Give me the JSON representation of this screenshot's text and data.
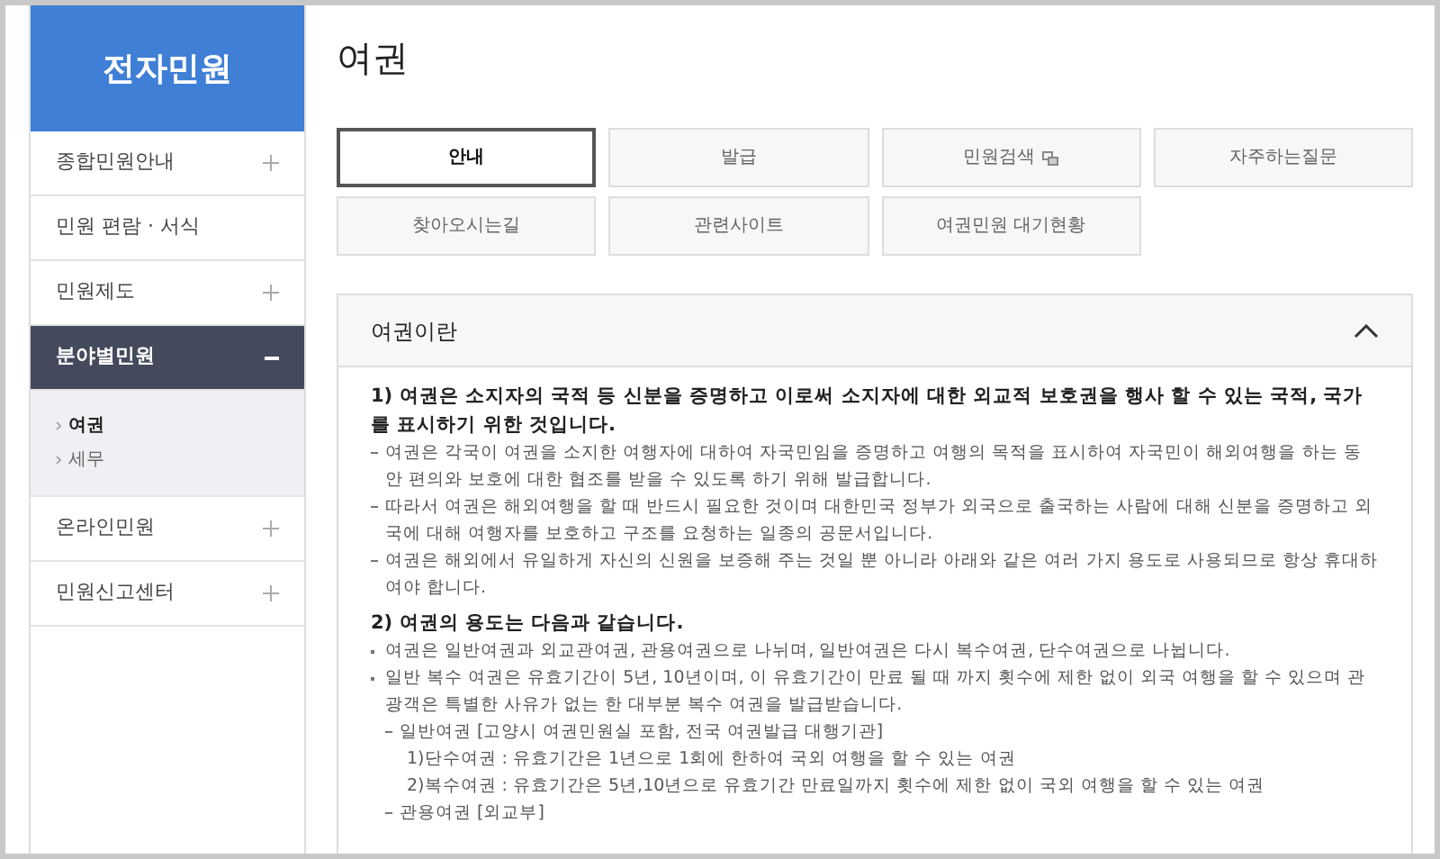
{
  "sidebar": {
    "title": "전자민원",
    "items": [
      {
        "label": "종합민원안내",
        "expandable": true,
        "expanded": false
      },
      {
        "label": "민원 편람 · 서식",
        "expandable": false,
        "expanded": false
      },
      {
        "label": "민원제도",
        "expandable": true,
        "expanded": false
      },
      {
        "label": "분야별민원",
        "expandable": true,
        "expanded": true,
        "children": [
          {
            "label": "여권",
            "selected": true
          },
          {
            "label": "세무",
            "selected": false
          }
        ]
      },
      {
        "label": "온라인민원",
        "expandable": true,
        "expanded": false
      },
      {
        "label": "민원신고센터",
        "expandable": true,
        "expanded": false
      }
    ]
  },
  "page_title": "여권",
  "tabs": [
    {
      "label": "안내",
      "selected": true,
      "external": false
    },
    {
      "label": "발급",
      "selected": false,
      "external": false
    },
    {
      "label": "민원검색",
      "selected": false,
      "external": true
    },
    {
      "label": "자주하는질문",
      "selected": false,
      "external": false
    },
    {
      "label": "찾아오시는길",
      "selected": false,
      "external": false
    },
    {
      "label": "관련사이트",
      "selected": false,
      "external": false
    },
    {
      "label": "여권민원 대기현황",
      "selected": false,
      "external": false
    }
  ],
  "panel": {
    "title": "여권이란",
    "expanded": true,
    "sections": [
      {
        "heading": "1) 여권은 소지자의 국적 등 신분을 증명하고 이로써 소지자에 대한 외교적 보호권을 행사 할 수 있는 국적, 국가를 표시하기 위한 것입니다.",
        "items": [
          {
            "kind": "dash",
            "text": "여권은 각국이 여권을 소지한 여행자에 대하여 자국민임을 증명하고 여행의 목적을 표시하여 자국민이 해외여행을 하는 동안 편의와 보호에 대한 협조를 받을 수 있도록 하기 위해 발급합니다."
          },
          {
            "kind": "dash",
            "text": "따라서 여권은 해외여행을 할 때 반드시 필요한 것이며 대한민국 정부가 외국으로 출국하는 사람에 대해 신분을 증명하고 외국에 대해 여행자를 보호하고 구조를 요청하는 일종의 공문서입니다."
          },
          {
            "kind": "dash",
            "text": "여권은 해외에서 유일하게 자신의 신원을 보증해 주는 것일 뿐 아니라 아래와 같은 여러 가지 용도로 사용되므로 항상 휴대하여야 합니다."
          }
        ]
      },
      {
        "heading": "2) 여권의 용도는 다음과 같습니다.",
        "items": [
          {
            "kind": "bullet",
            "text": "여권은 일반여권과 외교관여권, 관용여권으로 나뉘며, 일반여권은 다시 복수여권, 단수여권으로 나뉩니다."
          },
          {
            "kind": "bullet",
            "text": "일반 복수 여권은 유효기간이 5년, 10년이며, 이 유효기간이 만료 될 때 까지 횟수에 제한 없이 외국 여행을 할 수 있으며 관광객은 특별한 사유가 없는 한 대부분 복수 여권을 발급받습니다."
          },
          {
            "kind": "subdash",
            "text": "일반여권 [고양시 여권민원실 포함, 전국 여권발급 대행기관]"
          },
          {
            "kind": "indent",
            "text": "1)단수여권 : 유효기간은 1년으로 1회에 한하여 국외 여행을 할 수 있는 여권"
          },
          {
            "kind": "indent",
            "text": "2)복수여권 : 유효기간은 5년,10년으로 유효기간 만료일까지 횟수에 제한 없이 국외 여행을 할 수 있는 여권"
          },
          {
            "kind": "subdash",
            "text": "관용여권 [외교부]"
          }
        ]
      }
    ]
  }
}
